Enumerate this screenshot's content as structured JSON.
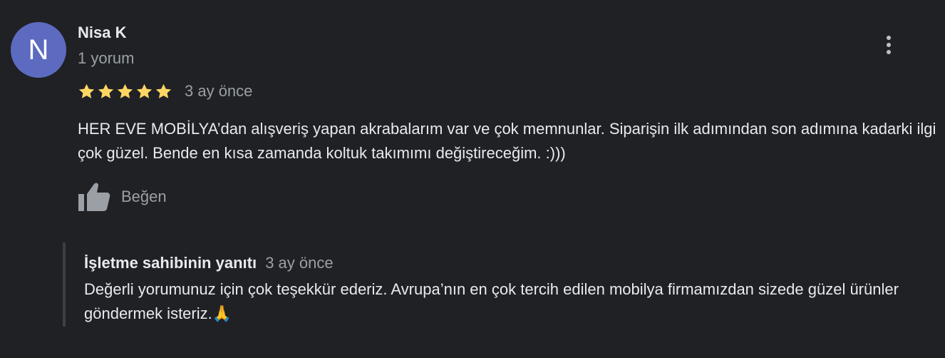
{
  "reviewer": {
    "initial": "N",
    "name": "Nisa K",
    "review_count": "1 yorum",
    "avatar_color": "#5c6bc0"
  },
  "review": {
    "rating": 5,
    "max_rating": 5,
    "star_color": "#fdd663",
    "date": "3 ay önce",
    "text": "HER EVE MOBİLYA’dan alışveriş yapan akrabalarım var ve çok memnunlar. Siparişin ilk adımından son adımına kadarki ilgi çok güzel. Bende en kısa zamanda koltuk takımımı değiştireceğim. :)))"
  },
  "actions": {
    "like_label": "Beğen",
    "like_icon": "thumbs-up-icon",
    "menu_icon": "more-vert-icon"
  },
  "owner_reply": {
    "title": "İşletme sahibinin yanıtı",
    "date": "3 ay önce",
    "text": "Değerli yorumunuz için çok teşekkür ederiz. Avrupa’nın en çok tercih edilen mobilya firmamızdan sizede güzel ürünler göndermek isteriz.🙏"
  }
}
